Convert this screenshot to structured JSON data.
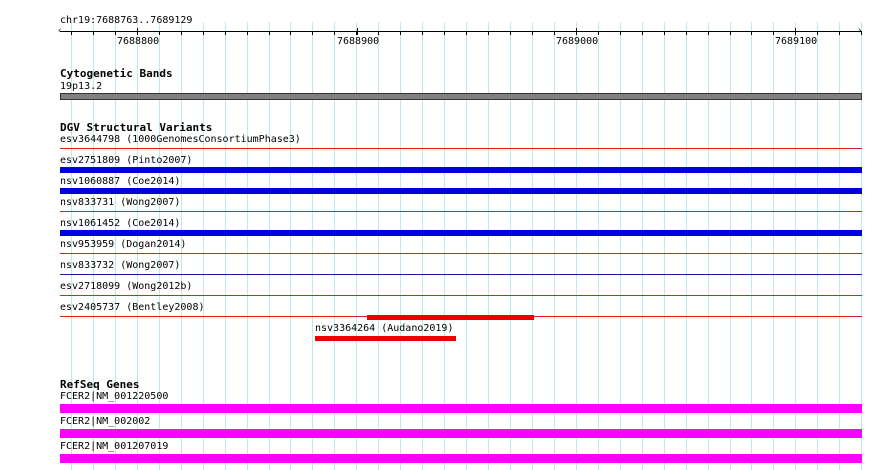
{
  "ruler": {
    "region": "chr19:7688763..7689129",
    "ticks": [
      "7688800",
      "7688900",
      "7689000",
      "7689100"
    ]
  },
  "cytoband": {
    "title": "Cytogenetic Bands",
    "band": "19p13.2",
    "color": "#808080"
  },
  "dgv": {
    "title": "DGV Structural Variants",
    "rows": [
      "esv3644798 (1000GenomesConsortiumPhase3)",
      "esv2751809 (Pinto2007)",
      "nsv1060887 (Coe2014)",
      "nsv833731 (Wong2007)",
      "nsv1061452 (Coe2014)",
      "nsv953959 (Dogan2014)",
      "nsv833732 (Wong2007)",
      "esv2718099 (Wong2012b)",
      "esv2405737 (Bentley2008)",
      "nsv3364264 (Audano2019)"
    ],
    "colors": {
      "gain": "#0000dd",
      "loss": "#ee0000",
      "separator": "#e02020"
    }
  },
  "refseq": {
    "title": "RefSeq Genes",
    "rows": [
      "FCER2|NM_001220500",
      "FCER2|NM_002002",
      "FCER2|NM_001207019"
    ],
    "color": "#ff00ff"
  },
  "grid_color": "#bfe6f5"
}
